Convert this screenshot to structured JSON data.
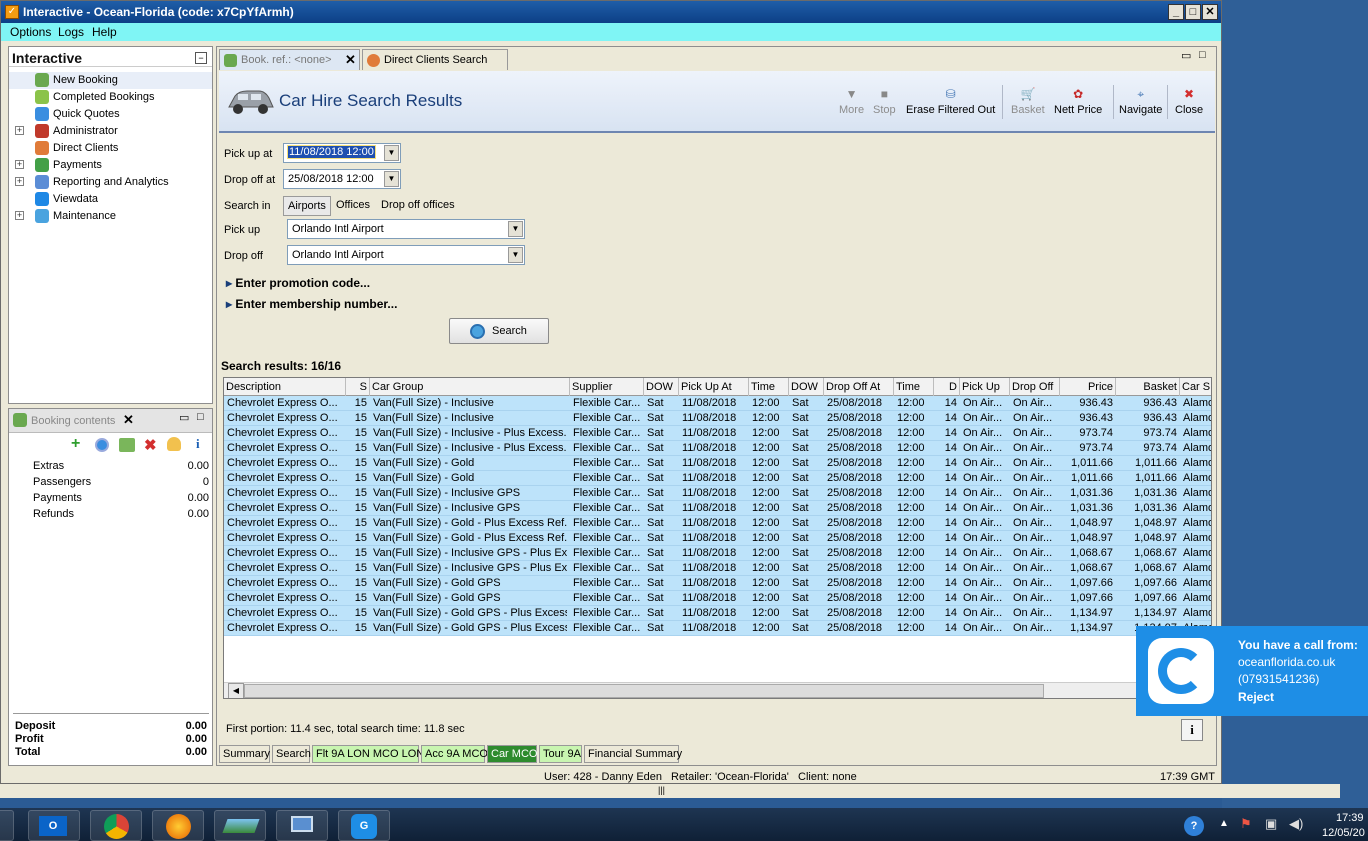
{
  "window": {
    "title": "Interactive - Ocean-Florida (code: x7CpYfArmh)"
  },
  "menu": [
    "Options",
    "Logs",
    "Help"
  ],
  "nav": {
    "title": "Interactive",
    "items": [
      {
        "label": "New Booking",
        "icon": "palm-tree-icon",
        "expandable": false
      },
      {
        "label": "Completed Bookings",
        "icon": "palm-tree-stack-icon",
        "expandable": false
      },
      {
        "label": "Quick Quotes",
        "icon": "clock-icon",
        "expandable": false
      },
      {
        "label": "Administrator",
        "icon": "person-icon",
        "expandable": true
      },
      {
        "label": "Direct Clients",
        "icon": "client-icon",
        "expandable": false
      },
      {
        "label": "Payments",
        "icon": "payments-icon",
        "expandable": true
      },
      {
        "label": "Reporting and Analytics",
        "icon": "reporting-icon",
        "expandable": true
      },
      {
        "label": "Viewdata",
        "icon": "viewdata-icon",
        "expandable": false
      },
      {
        "label": "Maintenance",
        "icon": "maintenance-icon",
        "expandable": true
      }
    ]
  },
  "booking": {
    "title": "Booking contents",
    "rows": [
      {
        "label": "Extras",
        "value": "0.00"
      },
      {
        "label": "Passengers",
        "value": "0"
      },
      {
        "label": "Payments",
        "value": "0.00"
      },
      {
        "label": "Refunds",
        "value": "0.00"
      }
    ],
    "totals": [
      {
        "label": "Deposit",
        "value": "0.00"
      },
      {
        "label": "Profit",
        "value": "0.00"
      },
      {
        "label": "Total",
        "value": "0.00"
      }
    ]
  },
  "tabs": [
    {
      "label": "Book. ref.: <none>"
    },
    {
      "label": "Direct Clients Search"
    }
  ],
  "results": {
    "title": "Car Hire Search Results",
    "toolbar": [
      "More",
      "Stop",
      "Erase Filtered Out",
      "Basket",
      "Nett Price",
      "Navigate",
      "Close"
    ],
    "form": {
      "pickup_at_label": "Pick up at",
      "pickup_at": "11/08/2018 12:00",
      "dropoff_at_label": "Drop off at",
      "dropoff_at": "25/08/2018 12:00",
      "search_in_label": "Search in",
      "search_in_options": [
        "Airports",
        "Offices",
        "Drop off offices"
      ],
      "pickup_label": "Pick up",
      "pickup": "Orlando Intl Airport",
      "dropoff_label": "Drop off",
      "dropoff": "Orlando Intl Airport",
      "promo": "Enter promotion code...",
      "membership": "Enter membership number...",
      "search_button": "Search"
    },
    "count_label": "Search results: 16/16",
    "columns": [
      "Description",
      "S",
      "Car Group",
      "Supplier",
      "DOW",
      "Pick Up At",
      "Time",
      "DOW",
      "Drop Off At",
      "Time",
      "D",
      "Pick Up",
      "Drop Off",
      "Price",
      "Basket",
      "Car S"
    ],
    "rows": [
      [
        "Chevrolet Express O...",
        "15",
        "Van(Full Size) - Inclusive",
        "Flexible Car...",
        "Sat",
        "11/08/2018",
        "12:00",
        "Sat",
        "25/08/2018",
        "12:00",
        "14",
        "On Air...",
        "On Air...",
        "936.43",
        "936.43",
        "Alamo"
      ],
      [
        "Chevrolet Express O...",
        "15",
        "Van(Full Size) - Inclusive",
        "Flexible Car...",
        "Sat",
        "11/08/2018",
        "12:00",
        "Sat",
        "25/08/2018",
        "12:00",
        "14",
        "On Air...",
        "On Air...",
        "936.43",
        "936.43",
        "Alamo"
      ],
      [
        "Chevrolet Express O...",
        "15",
        "Van(Full Size) - Inclusive - Plus Excess...",
        "Flexible Car...",
        "Sat",
        "11/08/2018",
        "12:00",
        "Sat",
        "25/08/2018",
        "12:00",
        "14",
        "On Air...",
        "On Air...",
        "973.74",
        "973.74",
        "Alamo"
      ],
      [
        "Chevrolet Express O...",
        "15",
        "Van(Full Size) - Inclusive - Plus Excess...",
        "Flexible Car...",
        "Sat",
        "11/08/2018",
        "12:00",
        "Sat",
        "25/08/2018",
        "12:00",
        "14",
        "On Air...",
        "On Air...",
        "973.74",
        "973.74",
        "Alamo"
      ],
      [
        "Chevrolet Express O...",
        "15",
        "Van(Full Size) - Gold",
        "Flexible Car...",
        "Sat",
        "11/08/2018",
        "12:00",
        "Sat",
        "25/08/2018",
        "12:00",
        "14",
        "On Air...",
        "On Air...",
        "1,011.66",
        "1,011.66",
        "Alamo"
      ],
      [
        "Chevrolet Express O...",
        "15",
        "Van(Full Size) - Gold",
        "Flexible Car...",
        "Sat",
        "11/08/2018",
        "12:00",
        "Sat",
        "25/08/2018",
        "12:00",
        "14",
        "On Air...",
        "On Air...",
        "1,011.66",
        "1,011.66",
        "Alamo"
      ],
      [
        "Chevrolet Express O...",
        "15",
        "Van(Full Size) - Inclusive GPS",
        "Flexible Car...",
        "Sat",
        "11/08/2018",
        "12:00",
        "Sat",
        "25/08/2018",
        "12:00",
        "14",
        "On Air...",
        "On Air...",
        "1,031.36",
        "1,031.36",
        "Alamo"
      ],
      [
        "Chevrolet Express O...",
        "15",
        "Van(Full Size) - Inclusive GPS",
        "Flexible Car...",
        "Sat",
        "11/08/2018",
        "12:00",
        "Sat",
        "25/08/2018",
        "12:00",
        "14",
        "On Air...",
        "On Air...",
        "1,031.36",
        "1,031.36",
        "Alamo"
      ],
      [
        "Chevrolet Express O...",
        "15",
        "Van(Full Size) - Gold - Plus Excess Ref...",
        "Flexible Car...",
        "Sat",
        "11/08/2018",
        "12:00",
        "Sat",
        "25/08/2018",
        "12:00",
        "14",
        "On Air...",
        "On Air...",
        "1,048.97",
        "1,048.97",
        "Alamo"
      ],
      [
        "Chevrolet Express O...",
        "15",
        "Van(Full Size) - Gold - Plus Excess Ref...",
        "Flexible Car...",
        "Sat",
        "11/08/2018",
        "12:00",
        "Sat",
        "25/08/2018",
        "12:00",
        "14",
        "On Air...",
        "On Air...",
        "1,048.97",
        "1,048.97",
        "Alamo"
      ],
      [
        "Chevrolet Express O...",
        "15",
        "Van(Full Size) - Inclusive GPS - Plus Ex...",
        "Flexible Car...",
        "Sat",
        "11/08/2018",
        "12:00",
        "Sat",
        "25/08/2018",
        "12:00",
        "14",
        "On Air...",
        "On Air...",
        "1,068.67",
        "1,068.67",
        "Alamo"
      ],
      [
        "Chevrolet Express O...",
        "15",
        "Van(Full Size) - Inclusive GPS - Plus Ex...",
        "Flexible Car...",
        "Sat",
        "11/08/2018",
        "12:00",
        "Sat",
        "25/08/2018",
        "12:00",
        "14",
        "On Air...",
        "On Air...",
        "1,068.67",
        "1,068.67",
        "Alamo"
      ],
      [
        "Chevrolet Express O...",
        "15",
        "Van(Full Size) - Gold GPS",
        "Flexible Car...",
        "Sat",
        "11/08/2018",
        "12:00",
        "Sat",
        "25/08/2018",
        "12:00",
        "14",
        "On Air...",
        "On Air...",
        "1,097.66",
        "1,097.66",
        "Alamo"
      ],
      [
        "Chevrolet Express O...",
        "15",
        "Van(Full Size) - Gold GPS",
        "Flexible Car...",
        "Sat",
        "11/08/2018",
        "12:00",
        "Sat",
        "25/08/2018",
        "12:00",
        "14",
        "On Air...",
        "On Air...",
        "1,097.66",
        "1,097.66",
        "Alamo"
      ],
      [
        "Chevrolet Express O...",
        "15",
        "Van(Full Size) - Gold GPS - Plus Excess...",
        "Flexible Car...",
        "Sat",
        "11/08/2018",
        "12:00",
        "Sat",
        "25/08/2018",
        "12:00",
        "14",
        "On Air...",
        "On Air...",
        "1,134.97",
        "1,134.97",
        "Alamo"
      ],
      [
        "Chevrolet Express O...",
        "15",
        "Van(Full Size) - Gold GPS - Plus Excess...",
        "Flexible Car...",
        "Sat",
        "11/08/2018",
        "12:00",
        "Sat",
        "25/08/2018",
        "12:00",
        "14",
        "On Air...",
        "On Air...",
        "1,134.97",
        "1,134.97",
        "Alamo"
      ]
    ],
    "timing": "First portion: 11.4 sec, total search time: 11.8 sec"
  },
  "bottom_tabs": [
    {
      "label": "Summary",
      "color": "#ece9d8",
      "text": "#000000"
    },
    {
      "label": "Search",
      "color": "#ece9d8",
      "text": "#000000"
    },
    {
      "label": "Flt 9A LON MCO LON",
      "color": "#c8f5b0",
      "text": "#000000"
    },
    {
      "label": "Acc 9A MCO",
      "color": "#c8f5b0",
      "text": "#000000"
    },
    {
      "label": "Car MCO",
      "color": "#2e8b2e",
      "text": "#ffffff"
    },
    {
      "label": "Tour 9A",
      "color": "#c8f5b0",
      "text": "#000000"
    },
    {
      "label": "Financial Summary",
      "color": "#ece9d8",
      "text": "#000000"
    }
  ],
  "statusbar": {
    "user": "User: 428 - Danny Eden",
    "retailer": "Retailer: 'Ocean-Florida'",
    "client": "Client: none",
    "time": "17:39 GMT"
  },
  "popup": {
    "title": "You have a call from:",
    "line1": "oceanflorida.co.uk",
    "line2": "(07931541236)",
    "action": "Reject"
  },
  "taskbar": {
    "time": "17:39",
    "date": "12/05/20",
    "apps": [
      "outlook-icon",
      "chrome-icon",
      "firefox-icon",
      "app-icon",
      "network-icon",
      "phone-app-icon"
    ]
  },
  "colors": {
    "accent": "#1e8ee6",
    "row_bg": "#bde3fa",
    "menubar": "#7ff5f5"
  }
}
